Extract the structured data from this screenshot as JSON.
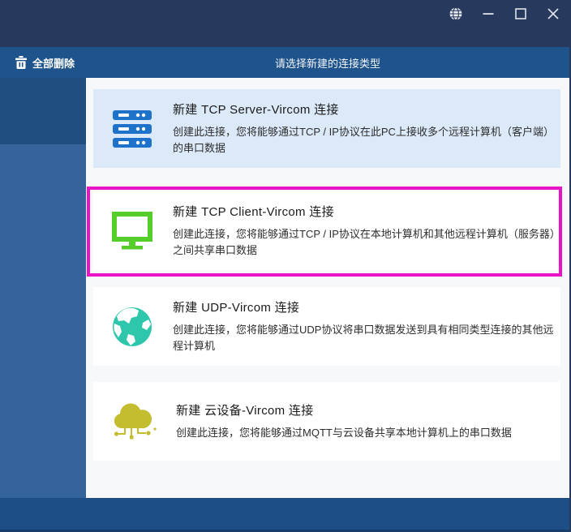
{
  "window": {
    "controls": [
      {
        "name": "language-globe-icon"
      },
      {
        "name": "minimize-icon"
      },
      {
        "name": "maximize-icon"
      },
      {
        "name": "close-icon"
      }
    ]
  },
  "header": {
    "delete_all_label": "全部删除",
    "delete_all_icon": "trash-icon",
    "title": "请选择新建的连接类型"
  },
  "cards": [
    {
      "id": "tcp-server",
      "icon": "server-icon",
      "icon_color": "#1f72c9",
      "title": "新建 TCP Server-Vircom 连接",
      "description": "创建此连接，您将能够通过TCP / IP协议在此PC上接收多个远程计算机（客户端）的串口数据",
      "highlighted": false
    },
    {
      "id": "tcp-client",
      "icon": "monitor-icon",
      "icon_color": "#55cd2a",
      "title": "新建 TCP Client-Vircom 连接",
      "description": "创建此连接，您将能够通过TCP / IP协议在本地计算机和其他远程计算机（服务器）之间共享串口数据",
      "highlighted": true
    },
    {
      "id": "udp",
      "icon": "globe-icon",
      "icon_color": "#2fc7ab",
      "title": "新建 UDP-Vircom  连接",
      "description": "创建此连接，您将能够通过UDP协议将串口数据发送到具有相同类型连接的其他远程计算机",
      "highlighted": false
    },
    {
      "id": "cloud-device",
      "icon": "cloud-icon",
      "icon_color": "#c3bd2f",
      "title": "新建 云设备-Vircom 连接",
      "description": "创建此连接，您将能够通过MQTT与云设备共享本地计算机上的串口数据",
      "highlighted": false
    }
  ],
  "colors": {
    "titlebar": "#273a5d",
    "headerbar": "#1e538c",
    "sidebar": "#35639b",
    "sidebar_selected": "#1e4d80",
    "bottombar": "#1d4e85",
    "main_background": "#f7f8fa",
    "card_tinted": "#dce9f9",
    "highlight_border": "#e912c4",
    "server_icon": "#1f72c9",
    "monitor_icon": "#55cd2a",
    "globe_icon": "#2fc7ab",
    "cloud_icon": "#c3bd2f"
  }
}
